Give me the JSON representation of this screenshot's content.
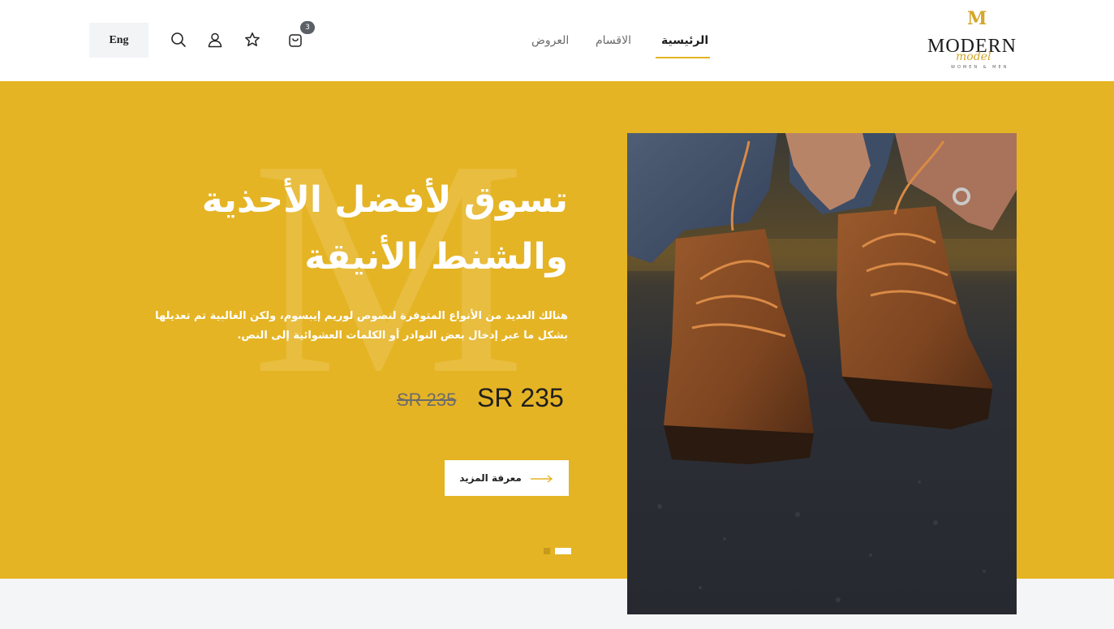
{
  "header": {
    "lang_label": "Eng",
    "cart_count": "3",
    "nav": [
      {
        "label": "الرئيسية",
        "active": true
      },
      {
        "label": "الاقسام",
        "active": false
      },
      {
        "label": "العروض",
        "active": false
      }
    ],
    "icons": [
      "search-icon",
      "user-icon",
      "star-icon",
      "cart-icon"
    ]
  },
  "logo": {
    "monogram": "M",
    "word": "MODERN",
    "script": "model",
    "tagline": "WOMEN & MEN"
  },
  "hero": {
    "watermark": "M",
    "title": "تسوق لأفضل الأحذية والشنط الأنيقة",
    "description": "هنالك العديد من الأنواع المتوفرة لنصوص لوريم إيبسوم، ولكن الغالبية تم تعديلها بشكل ما عبر إدخال بعض النوادر أو الكلمات العشوائية إلى النص.",
    "price_current": "SR 235",
    "price_old": "SR 235",
    "button_label": "معرفة المزيد",
    "slides": 2,
    "active_slide": 1
  },
  "colors": {
    "accent": "#e5b424",
    "text_dark": "#1f1f1f",
    "background": "#f4f5f7"
  }
}
